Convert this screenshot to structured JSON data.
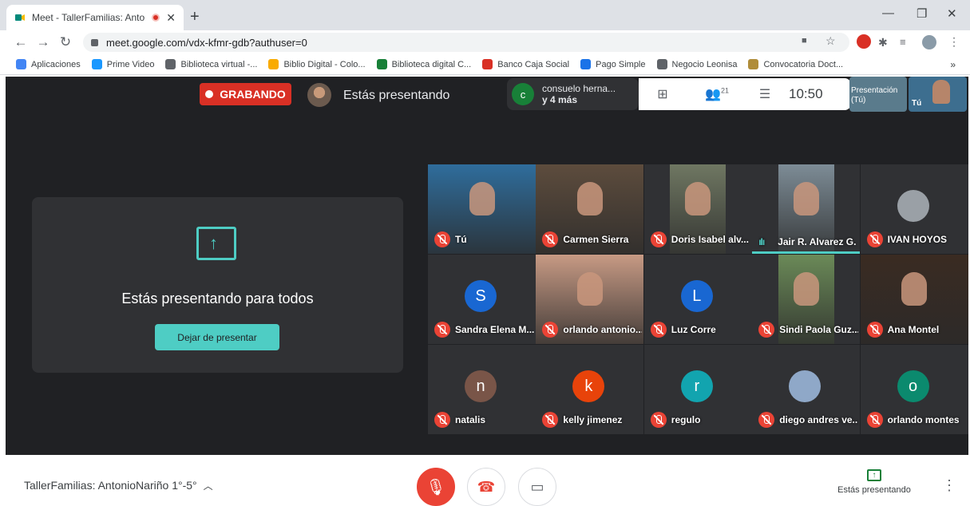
{
  "browser": {
    "tab_title": "Meet - TallerFamilias: Antoni",
    "tab_close": "✕",
    "new_tab": "+",
    "url": "meet.google.com/vdx-kfmr-gdb?authuser=0",
    "bookmarks": [
      {
        "label": "Aplicaciones",
        "icon": "apps-icon",
        "color": "#4285f4"
      },
      {
        "label": "Prime Video",
        "icon": "prime-video-icon",
        "color": "#1a98ff"
      },
      {
        "label": "Biblioteca virtual -...",
        "icon": "globe-icon",
        "color": "#5f6368"
      },
      {
        "label": "Biblio Digital - Colo...",
        "icon": "book-icon",
        "color": "#f9ab00"
      },
      {
        "label": "Biblioteca digital C...",
        "icon": "library-icon",
        "color": "#188038"
      },
      {
        "label": "Banco Caja Social",
        "icon": "bank-icon",
        "color": "#d93025"
      },
      {
        "label": "Pago Simple",
        "icon": "payment-icon",
        "color": "#1a73e8"
      },
      {
        "label": "Negocio Leonisa",
        "icon": "leaf-icon",
        "color": "#5f6368"
      },
      {
        "label": "Convocatoria Doct...",
        "icon": "shield-icon",
        "color": "#b08d3a"
      }
    ],
    "bookmarks_more": "»"
  },
  "meet": {
    "recording_label": "GRABANDO",
    "presenting_label": "Estás presentando",
    "participants_chip": {
      "initial": "c",
      "line1": "consuelo herna...",
      "line2": "y 4 más"
    },
    "people_count": "21",
    "time": "10:50",
    "thumb_presentation": {
      "title": "Presentación",
      "sub": "(Tú)"
    },
    "thumb_self": "Tú",
    "card": {
      "title": "Estás presentando para todos",
      "button": "Dejar de presentar"
    },
    "tiles": [
      {
        "name": "Tú",
        "mic": "off",
        "type": "video",
        "bg": "#2f6d9c"
      },
      {
        "name": "Carmen Sierra",
        "mic": "off",
        "type": "video",
        "bg": "#5d4c3d"
      },
      {
        "name": "Doris Isabel alv...",
        "mic": "off",
        "type": "video",
        "bg": "#6f7762"
      },
      {
        "name": "Jair R. Alvarez G.",
        "mic": "speaking",
        "type": "video",
        "bg": "#7d8c96",
        "active": true
      },
      {
        "name": "IVAN HOYOS",
        "mic": "off",
        "type": "photo",
        "bg": "#9aa0a6"
      },
      {
        "name": "Sandra Elena M...",
        "mic": "off",
        "type": "avatar",
        "initial": "S",
        "bg": "#1967d2"
      },
      {
        "name": "orlando antonio...",
        "mic": "off",
        "type": "video",
        "bg": "#c79a84"
      },
      {
        "name": "Luz Corre",
        "mic": "off",
        "type": "avatar",
        "initial": "L",
        "bg": "#1967d2"
      },
      {
        "name": "Sindi Paola Guz...",
        "mic": "off",
        "type": "video",
        "bg": "#6b8a58"
      },
      {
        "name": "Ana Montel",
        "mic": "off",
        "type": "video",
        "bg": "#3a2b22"
      },
      {
        "name": "natalis",
        "mic": "off",
        "type": "avatar",
        "initial": "n",
        "bg": "#795548"
      },
      {
        "name": "kelly jimenez",
        "mic": "off",
        "type": "avatar",
        "initial": "k",
        "bg": "#e8430a"
      },
      {
        "name": "regulo",
        "mic": "off",
        "type": "avatar",
        "initial": "r",
        "bg": "#12a4af"
      },
      {
        "name": "diego andres ve...",
        "mic": "off",
        "type": "photo",
        "bg": "#8fa8c8"
      },
      {
        "name": "orlando montes",
        "mic": "off",
        "type": "avatar",
        "initial": "o",
        "bg": "#0b8a6e"
      }
    ]
  },
  "bottom": {
    "meeting_title": "TallerFamilias: AntonioNariño 1°-5°",
    "present_label": "Estás presentando"
  }
}
